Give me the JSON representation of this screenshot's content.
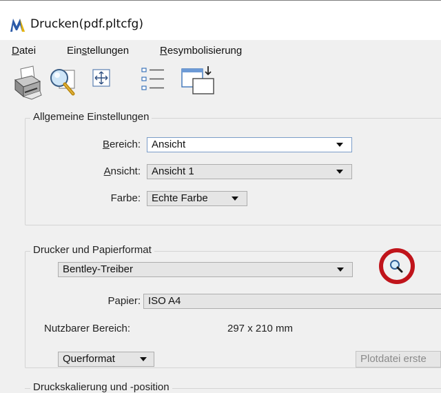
{
  "window": {
    "title": "Drucken(pdf.pltcfg)"
  },
  "menubar": {
    "items": [
      {
        "label_u": "D",
        "label_rest": "atei"
      },
      {
        "label_pre": "Ein",
        "label_u": "s",
        "label_rest": "tellungen"
      },
      {
        "label_u": "R",
        "label_rest": "esymbolisierung"
      }
    ]
  },
  "toolbar": {
    "icons": [
      "printer-icon",
      "preview-magnifier-icon",
      "fit-extents-icon",
      "list-icon",
      "page-setup-icon"
    ]
  },
  "general": {
    "title": "Allgemeine Einstellungen",
    "area_label_u": "B",
    "area_label_rest": "ereich:",
    "area_value": "Ansicht",
    "view_label_u": "A",
    "view_label_rest": "nsicht:",
    "view_value": "Ansicht 1",
    "color_label": "Farbe:",
    "color_value": "Echte Farbe"
  },
  "printer": {
    "title": "Drucker und Papierformat",
    "driver_value": "Bentley-Treiber",
    "paper_label": "Papier:",
    "paper_value": "ISO A4",
    "usable_area_label": "Nutzbarer Bereich:",
    "usable_area_value": "297 x 210 mm",
    "orientation_value": "Querformat",
    "plotfile_button": "Plotdatei erste"
  },
  "scaling": {
    "title": "Druckskalierung und -position"
  },
  "colors": {
    "highlight": "#c0141b",
    "app_icon": "#2b5aa8"
  }
}
